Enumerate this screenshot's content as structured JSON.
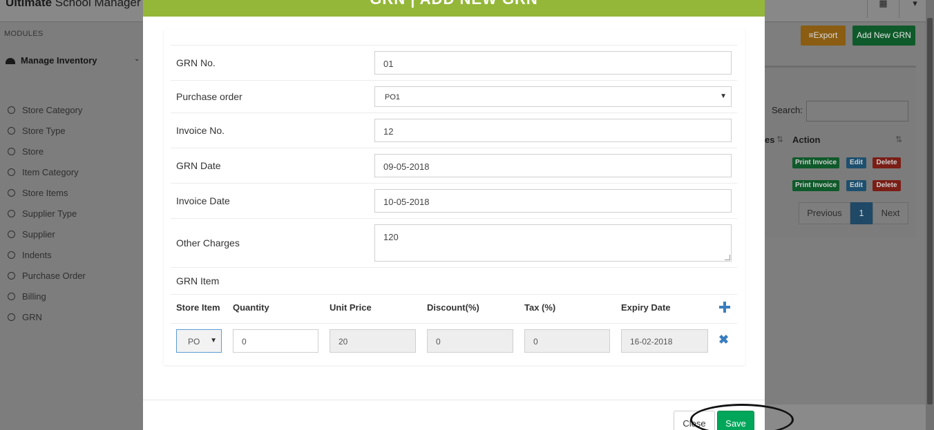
{
  "background": {
    "app_title_bold": "Ultimate",
    "app_title_rest": " School Manager",
    "top_icons": [
      "grid-icon",
      "caret-down-icon"
    ],
    "sidebar": {
      "section_label": "MODULES",
      "group_label": "Manage Inventory",
      "items": [
        "Store Category",
        "Store Type",
        "Store",
        "Item Category",
        "Store Items",
        "Supplier Type",
        "Supplier",
        "Indents",
        "Purchase Order",
        "Billing",
        "GRN"
      ]
    },
    "toolbar": {
      "export_label": "Export",
      "add_label": "Add New GRN"
    },
    "table": {
      "search_label": "Search:",
      "header_fragment": "es",
      "action_header": "Action",
      "row_buttons": {
        "print": "Print Invoice",
        "edit": "Edit",
        "delete": "Delete"
      },
      "pagination": {
        "prev": "Previous",
        "page": "1",
        "next": "Next"
      }
    }
  },
  "modal": {
    "title": "GRN | ADD NEW GRN",
    "fields": {
      "grn_no": {
        "label": "GRN No.",
        "value": "01"
      },
      "purchase_order": {
        "label": "Purchase order",
        "value": "PO1"
      },
      "invoice_no": {
        "label": "Invoice No.",
        "value": "12"
      },
      "grn_date": {
        "label": "GRN Date",
        "value": "09-05-2018"
      },
      "invoice_date": {
        "label": "Invoice Date",
        "value": "10-05-2018"
      },
      "other_charges": {
        "label": "Other Charges",
        "value": "120"
      }
    },
    "grn_item_label": "GRN Item",
    "columns": [
      "Store Item",
      "Quantity",
      "Unit Price",
      "Discount(%)",
      "Tax (%)",
      "Expiry Date"
    ],
    "item_row": {
      "store_item": "PO",
      "quantity": "0",
      "unit_price": "20",
      "discount": "0",
      "tax": "0",
      "expiry_date": "16-02-2018"
    },
    "footer": {
      "close_label": "Close",
      "save_label": "Save"
    }
  },
  "colors": {
    "header_green": "#94b73a",
    "save_green": "#00a65a",
    "icon_blue": "#3a7dbf"
  }
}
